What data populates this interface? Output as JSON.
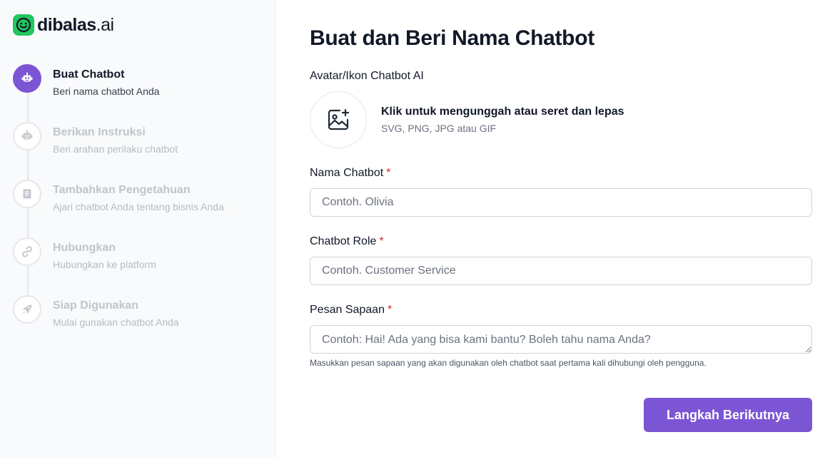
{
  "brand": {
    "name": "dibalas",
    "suffix": ".ai",
    "color": "#22c55e"
  },
  "sidebar": {
    "steps": [
      {
        "title": "Buat Chatbot",
        "subtitle": "Beri nama chatbot Anda",
        "icon": "robot-icon",
        "state": "active"
      },
      {
        "title": "Berikan Instruksi",
        "subtitle": "Beri arahan perilaku chatbot",
        "icon": "robot-icon",
        "state": "inactive"
      },
      {
        "title": "Tambahkan Pengetahuan",
        "subtitle": "Ajari chatbot Anda tentang bisnis Anda",
        "icon": "book-icon",
        "state": "inactive"
      },
      {
        "title": "Hubungkan",
        "subtitle": "Hubungkan ke platform",
        "icon": "link-icon",
        "state": "inactive"
      },
      {
        "title": "Siap Digunakan",
        "subtitle": "Mulai gunakan chatbot Anda",
        "icon": "rocket-icon",
        "state": "inactive"
      }
    ]
  },
  "main": {
    "title": "Buat dan Beri Nama Chatbot",
    "avatar": {
      "label": "Avatar/Ikon Chatbot AI",
      "upload_title": "Klik untuk mengunggah atau seret dan lepas",
      "upload_hint": "SVG, PNG, JPG atau GIF"
    },
    "fields": {
      "name": {
        "label": "Nama Chatbot",
        "required_mark": "*",
        "placeholder": "Contoh. Olivia",
        "value": ""
      },
      "role": {
        "label": "Chatbot Role",
        "required_mark": "*",
        "placeholder": "Contoh. Customer Service",
        "value": ""
      },
      "greeting": {
        "label": "Pesan Sapaan",
        "required_mark": "*",
        "placeholder": "Contoh: Hai! Ada yang bisa kami bantu? Boleh tahu nama Anda?",
        "value": "",
        "help": "Masukkan pesan sapaan yang akan digunakan oleh chatbot saat pertama kali dihubungi oleh pengguna."
      }
    },
    "next_label": "Langkah Berikutnya"
  },
  "colors": {
    "accent": "#7c55d4",
    "required": "#dc2626",
    "inactive_text": "#c0c4cc"
  }
}
